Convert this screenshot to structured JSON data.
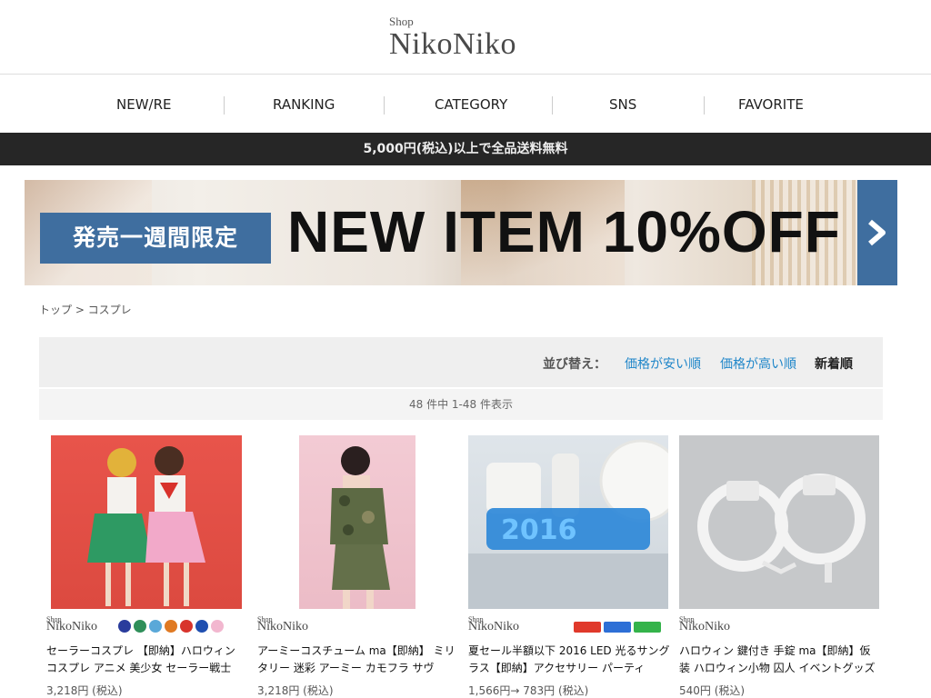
{
  "header": {
    "logo_small": "Shop",
    "logo_big": "NikoNiko"
  },
  "nav": [
    "NEW/RE",
    "RANKING",
    "CATEGORY",
    "SNS",
    "FAVORITE"
  ],
  "notice": "5,000円(税込)以上で全品送料無料",
  "banner": {
    "tag": "発売一週間限定",
    "headline": "NEW ITEM 10%OFF",
    "arrow_icon": "chevron-right-icon"
  },
  "breadcrumb": "トップ > コスプレ",
  "sort": {
    "label": "並び替え：",
    "options": [
      "価格が安い順",
      "価格が高い順",
      "新着順"
    ],
    "active": "新着順"
  },
  "count_text": "48 件中 1-48 件表示",
  "products": [
    {
      "brand_small": "Shop",
      "brand": "NikoNiko",
      "title": "セーラーコスプレ 【即納】ハロウィン コスプレ アニメ 美少女 セーラー戦士",
      "price": "3,218円 (税込)",
      "swatches": [
        "#2a3c9c",
        "#2f8f5a",
        "#5aa8d8",
        "#e07a23",
        "#d8342c",
        "#1f4fb0",
        "#f2b7cf"
      ]
    },
    {
      "brand_small": "Shop",
      "brand": "NikoNiko",
      "title": "アーミーコスチューム ma【即納】 ミリタリー 迷彩 アーミー カモフラ サヴ",
      "price": "3,218円 (税込)",
      "swatches": []
    },
    {
      "brand_small": "Shop",
      "brand": "NikoNiko",
      "title": "夏セール半額以下 2016 LED 光るサングラス【即納】アクセサリー パーティ",
      "price": "1,566円→ 783円 (税込)",
      "swatches": [
        "#e0392b",
        "#2d6fd6",
        "#34b34a"
      ]
    },
    {
      "brand_small": "Shop",
      "brand": "NikoNiko",
      "title": "ハロウィン 鍵付き 手錠 ma【即納】仮装 ハロウィン小物 囚人 イベントグッズ",
      "price": "540円 (税込)",
      "swatches": []
    }
  ]
}
